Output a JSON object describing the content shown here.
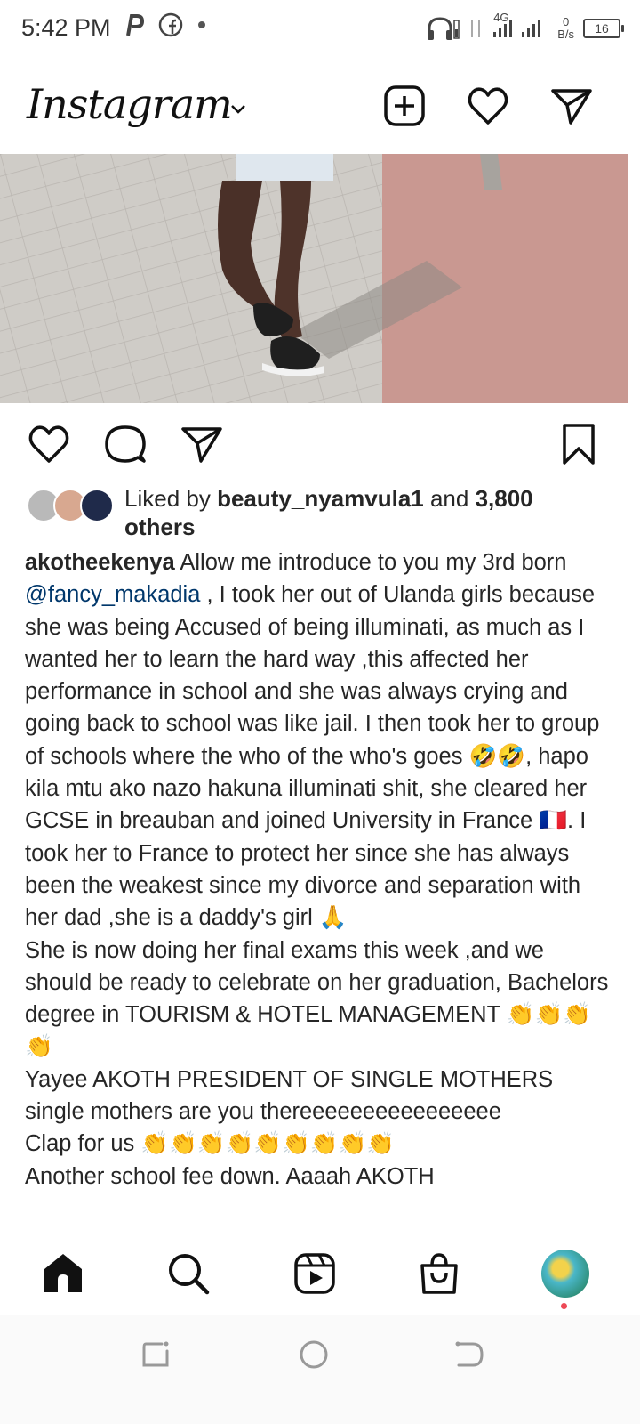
{
  "status_bar": {
    "time": "5:42 PM",
    "network_label": "4G",
    "speed_value": "0",
    "speed_unit": "B/s",
    "battery": "16"
  },
  "header": {
    "app_title": "Instagram"
  },
  "likes": {
    "prefix": "Liked by ",
    "user": "beauty_nyamvula1",
    "middle": " and ",
    "count": "3,800 others"
  },
  "caption": {
    "username": "akotheekenya",
    "text_1": " Allow me introduce to you my 3rd born ",
    "mention": "@fancy_makadia",
    "text_2": " , I took her out of Ulanda girls because she was being Accused of being illuminati, as much as I wanted her to learn the hard way ,this affected her performance in school and she was always crying and going back to school was like jail. I then took her to group of schools where the who of the who's goes 🤣🤣, hapo kila mtu ako nazo hakuna illuminati shit, she cleared her GCSE in  breauban and joined University in France 🇫🇷. I took her to France to protect her since she has always been the weakest since my divorce and separation with her dad ,she is a daddy's girl 🙏",
    "line_2": "She is now doing her final exams this week ,and we should be ready to celebrate on her graduation, Bachelors degree in TOURISM & HOTEL MANAGEMENT 👏👏👏👏",
    "line_3": "Yayee AKOTH PRESIDENT OF SINGLE MOTHERS single mothers are you thereeeeeeeeeeeeeeee",
    "line_4": "Clap for us 👏👏👏👏👏👏👏👏👏",
    "line_5": "Another school fee down. Aaaah AKOTH"
  },
  "colors": {
    "text": "#262626",
    "mention": "#00376b",
    "notification": "#ed4956"
  },
  "icons": [
    "home-icon",
    "search-icon",
    "reels-icon",
    "shop-icon",
    "heart-icon",
    "comment-icon",
    "share-icon",
    "save-icon",
    "new-post-icon",
    "messenger-icon"
  ]
}
